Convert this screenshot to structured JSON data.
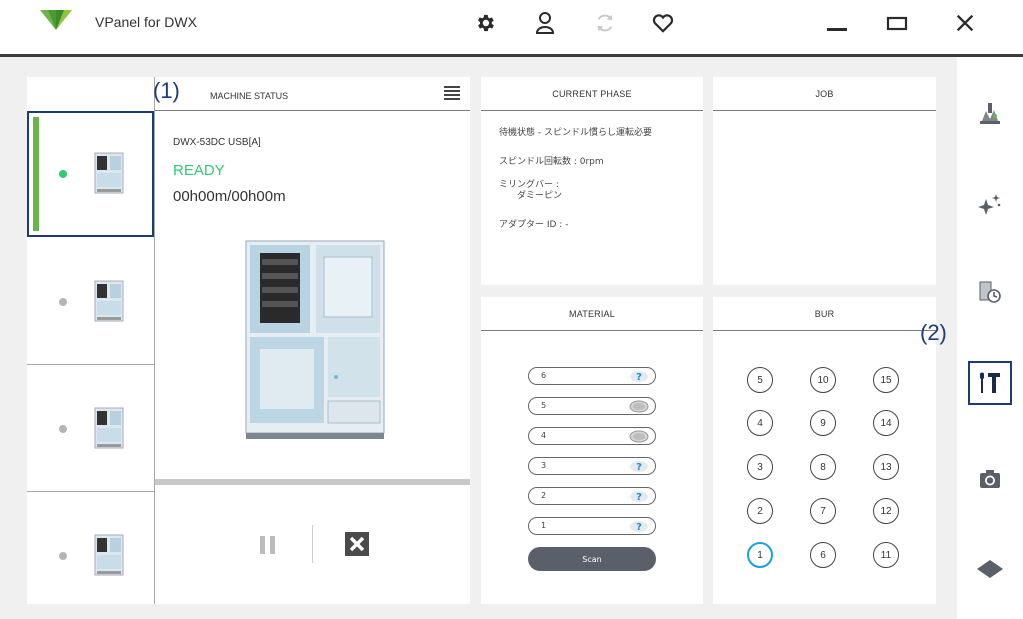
{
  "app": {
    "title": "VPanel for DWX",
    "brand_color": "#6ab54a",
    "accent_color": "#1b3b7c",
    "icons": [
      "gear-icon",
      "user-icon",
      "refresh-icon",
      "heart-icon",
      "minimize-icon",
      "maximize-icon",
      "close-icon"
    ]
  },
  "annotations": {
    "one": "(1)",
    "two": "(2)"
  },
  "machine_status": {
    "header": "MACHINE STATUS",
    "machine_name": "DWX-53DC USB[A]",
    "state": "READY",
    "state_color": "#2ecc71",
    "time": "00h00m/00h00m"
  },
  "current_phase": {
    "header": "CURRENT PHASE",
    "status": "待機状態 - スピンドル慣らし運転必要",
    "spindle": "スピンドル回転数 : 0rpm",
    "milling_bar_label": "ミリングバー :",
    "milling_bar_value": "ダミーピン",
    "adapter": "アダプター ID : -"
  },
  "job": {
    "header": "JOB"
  },
  "material": {
    "header": "MATERIAL",
    "slots": [
      {
        "num": "6",
        "icon": "question-icon"
      },
      {
        "num": "5",
        "icon": "disc-icon"
      },
      {
        "num": "4",
        "icon": "disc-icon"
      },
      {
        "num": "3",
        "icon": "question-icon"
      },
      {
        "num": "2",
        "icon": "question-icon"
      },
      {
        "num": "1",
        "icon": "question-icon"
      }
    ],
    "question_mark": "?",
    "scan_label": "Scan"
  },
  "bur": {
    "header": "BUR",
    "numbers": [
      "5",
      "10",
      "15",
      "4",
      "9",
      "14",
      "3",
      "8",
      "13",
      "2",
      "7",
      "12",
      "1",
      "6",
      "11"
    ],
    "active": "1",
    "active_color": "#1aa0e0"
  },
  "sidebar": {
    "items": [
      "milling-icon",
      "sparkle-icon",
      "schedule-icon",
      "tools-icon",
      "camera-icon",
      "diamond-icon"
    ],
    "selected": "tools-icon"
  }
}
